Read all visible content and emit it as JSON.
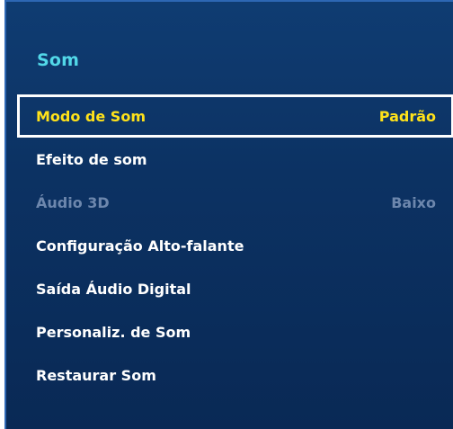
{
  "panel": {
    "title": "Som"
  },
  "menu": {
    "items": [
      {
        "label": "Modo de Som",
        "value": "Padrão",
        "state": "selected"
      },
      {
        "label": "Efeito de som",
        "value": "",
        "state": "normal"
      },
      {
        "label": "Áudio 3D",
        "value": "Baixo",
        "state": "disabled"
      },
      {
        "label": "Configuração Alto-falante",
        "value": "",
        "state": "normal"
      },
      {
        "label": "Saída Áudio Digital",
        "value": "",
        "state": "normal"
      },
      {
        "label": "Personaliz. de Som",
        "value": "",
        "state": "normal"
      },
      {
        "label": "Restaurar Som",
        "value": "",
        "state": "normal"
      }
    ]
  },
  "colors": {
    "panel_background": "#0c3263",
    "title": "#52d8e8",
    "selected_text": "#ffe21a",
    "normal_text": "#ffffff",
    "disabled_text": "#6d87ad",
    "focus_border": "#ffffff"
  }
}
